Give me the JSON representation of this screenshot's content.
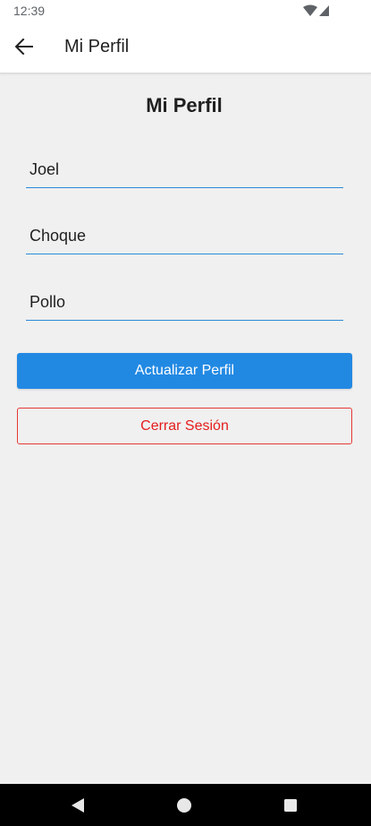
{
  "status_bar": {
    "time": "12:39",
    "icons": [
      "wifi-icon",
      "cellular-signal-icon"
    ]
  },
  "app_bar": {
    "back_icon": "arrow-left-icon",
    "title": "Mi Perfil"
  },
  "profile": {
    "heading": "Mi Perfil",
    "fields": [
      {
        "value": "Joel"
      },
      {
        "value": "Choque"
      },
      {
        "value": "Pollo"
      }
    ],
    "update_label": "Actualizar Perfil",
    "logout_label": "Cerrar Sesión"
  },
  "colors": {
    "primary": "#2289e3",
    "danger": "#e51c1c",
    "field_underline": "#2a8ad8",
    "background": "#f0f0f0"
  },
  "nav_bar": {
    "icons": [
      "nav-back-icon",
      "nav-home-icon",
      "nav-recents-icon"
    ]
  }
}
